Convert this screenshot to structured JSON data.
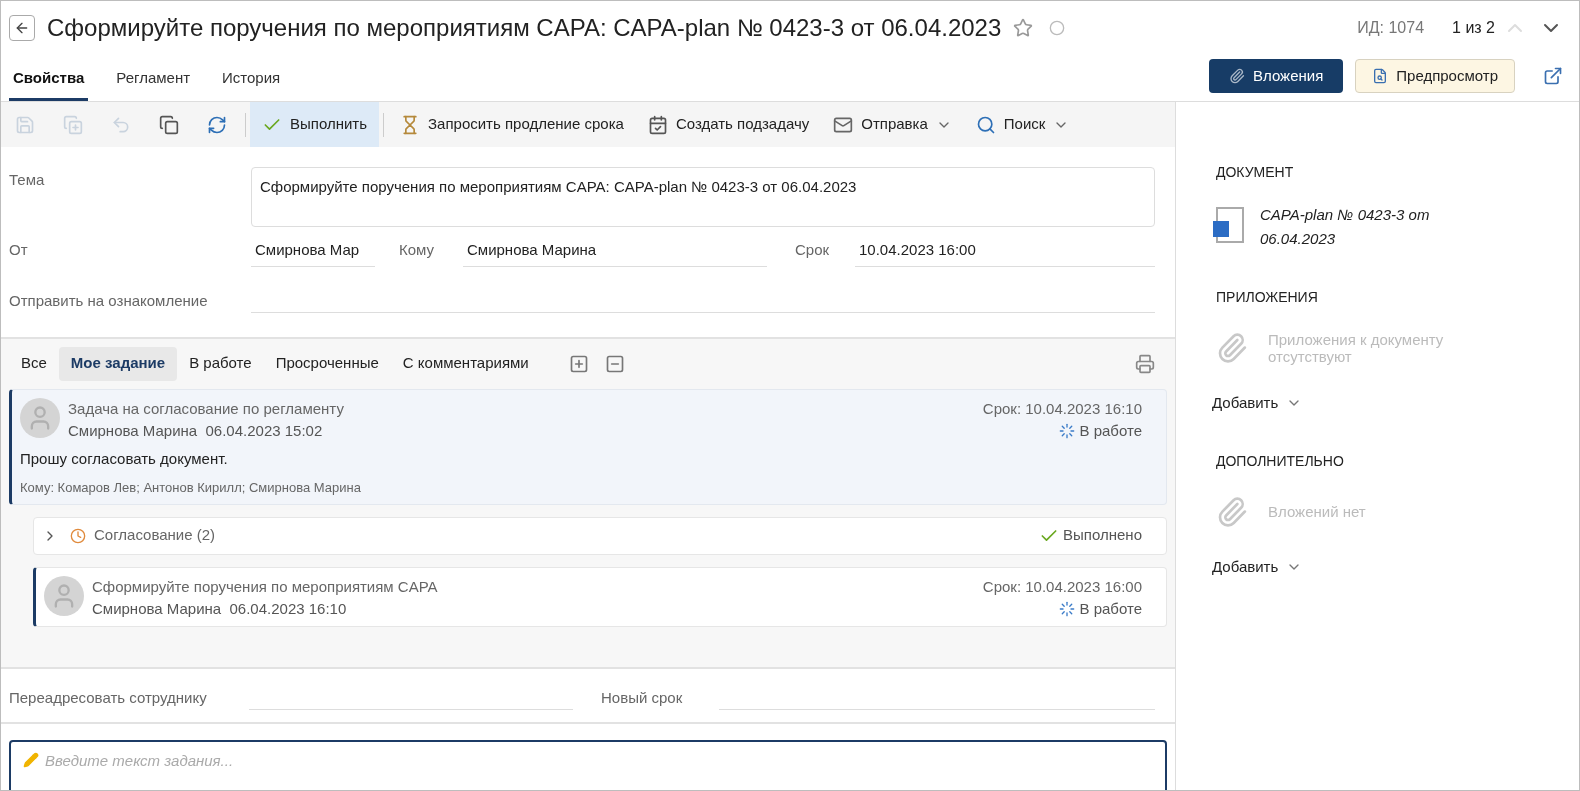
{
  "header": {
    "title": "Сформируйте поручения по мероприятиям CAPA: CAPA-plan № 0423-3 от 06.04.2023",
    "starred": false,
    "id_label": "ИД: 1074",
    "pager": "1 из 2",
    "prev_disabled": true
  },
  "tabs": [
    {
      "label": "Свойства",
      "selected": true
    },
    {
      "label": "Регламент",
      "selected": false
    },
    {
      "label": "История",
      "selected": false
    }
  ],
  "header_buttons": [
    {
      "kind": "primary",
      "label": "Вложения"
    },
    {
      "kind": "preview",
      "label": "Предпросмотр"
    }
  ],
  "toolbar": [
    {
      "kind": "save",
      "disabled": true
    },
    {
      "kind": "save-as",
      "disabled": true
    },
    {
      "kind": "undo",
      "disabled": true
    },
    {
      "kind": "copy",
      "disabled": false
    },
    {
      "kind": "refresh",
      "disabled": false
    },
    {
      "kind": "complete",
      "label": "Выполнить",
      "selected": true
    },
    {
      "kind": "extend",
      "label": "Запросить продление срока",
      "selected": false
    },
    {
      "kind": "subtask",
      "label": "Создать подзадачу",
      "selected": false
    },
    {
      "kind": "send",
      "label": "Отправка",
      "selected": false,
      "dropdown": true
    },
    {
      "kind": "search",
      "label": "Поиск",
      "selected": false,
      "dropdown": true
    }
  ],
  "form": {
    "subject_label": "Тема",
    "subject": "Сформируйте поручения по мероприятиям CAPA: CAPA-plan № 0423-3 от 06.04.2023",
    "from_label": "От",
    "from": "Смирнова Мар",
    "to_label": "Кому",
    "to": "Смирнова Марина",
    "due_label": "Срок",
    "due": "10.04.2023 16:00",
    "cc_label": "Отправить на ознакомление"
  },
  "task_filters": [
    {
      "label": "Все",
      "selected": false
    },
    {
      "label": "Мое задание",
      "selected": true
    },
    {
      "label": "В работе",
      "selected": false
    },
    {
      "label": "Просроченные",
      "selected": false
    },
    {
      "label": "С комментариями",
      "selected": false
    }
  ],
  "tasks": [
    {
      "kind": "task",
      "title": "Задача на согласование по регламенту",
      "author": "Смирнова Марина",
      "date": "06.04.2023 15:02",
      "due": "Срок: 10.04.2023 16:10",
      "status": "В работе",
      "highlighted": true,
      "text": "Прошу согласовать документ.",
      "recipients": "Кому: Комаров Лев; Антонов Кирилл; Смирнова Марина",
      "children": [
        {
          "kind": "group",
          "title": "Согласование (2)",
          "status": "Выполнено",
          "expanded": false
        },
        {
          "kind": "task",
          "title": "Сформируйте поручения по мероприятиям CAPA",
          "author": "Смирнова Марина",
          "date": "06.04.2023 16:10",
          "due": "Срок: 10.04.2023 16:00",
          "status": "В работе",
          "highlighted": false
        }
      ]
    }
  ],
  "redirect": {
    "label": "Переадресовать сотруднику",
    "new_due_label": "Новый срок"
  },
  "editor": {
    "placeholder": "Введите текст задания..."
  },
  "sidebar": {
    "document_heading": "ДОКУМЕНТ",
    "document": "CAPA-plan № 0423-3 от 06.04.2023",
    "sections": [
      {
        "heading": "ПРИЛОЖЕНИЯ",
        "empty": "Приложения к документу отсутствуют",
        "add": "Добавить"
      },
      {
        "heading": "ДОПОЛНИТЕЛЬНО",
        "empty": "Вложений нет",
        "add": "Добавить"
      }
    ]
  }
}
